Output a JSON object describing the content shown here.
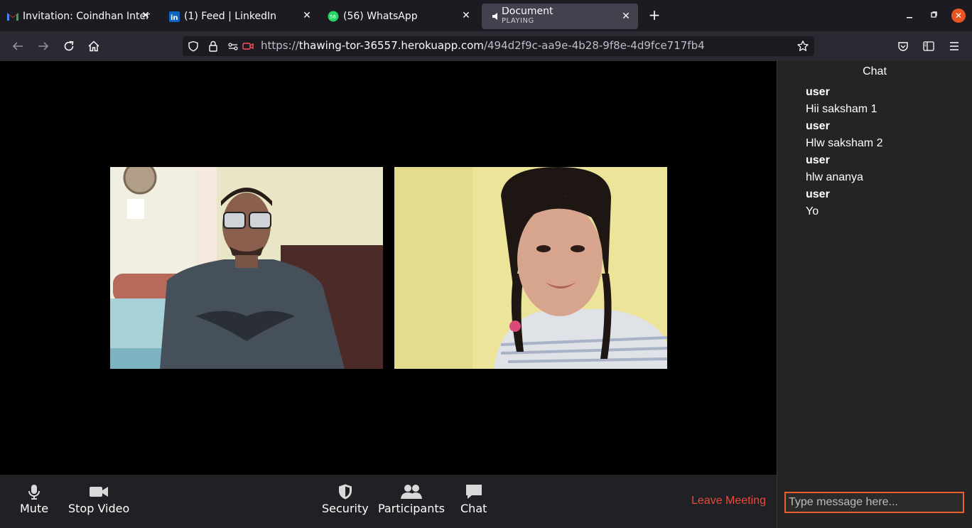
{
  "browser": {
    "tabs": [
      {
        "title": "Invitation: Coindhan Inter",
        "icon": "gmail-icon"
      },
      {
        "title": "(1) Feed | LinkedIn",
        "icon": "linkedin-icon"
      },
      {
        "title": "(56) WhatsApp",
        "icon": "whatsapp-icon",
        "badge": "56"
      },
      {
        "title": "Document",
        "subtitle": "PLAYING",
        "icon": "speaker-icon"
      }
    ],
    "url_prefix": "https://",
    "url_host": "thawing-tor-36557.herokuapp.com",
    "url_path": "/494d2f9c-aa9e-4b28-9f8e-4d9fce717fb4"
  },
  "toolbar": {
    "mute_label": "Mute",
    "stop_video_label": "Stop Video",
    "security_label": "Security",
    "participants_label": "Participants",
    "chat_label": "Chat",
    "leave_label": "Leave Meeting"
  },
  "chat": {
    "title": "Chat",
    "messages": [
      {
        "user": "user",
        "text": "Hii saksham 1"
      },
      {
        "user": "user",
        "text": "Hlw saksham 2"
      },
      {
        "user": "user",
        "text": "hlw ananya"
      },
      {
        "user": "user",
        "text": "Yo"
      }
    ],
    "input_placeholder": "Type message here..."
  },
  "colors": {
    "leave": "#e84a3c",
    "input_border": "#e8602c",
    "tab_active": "#42414d"
  }
}
